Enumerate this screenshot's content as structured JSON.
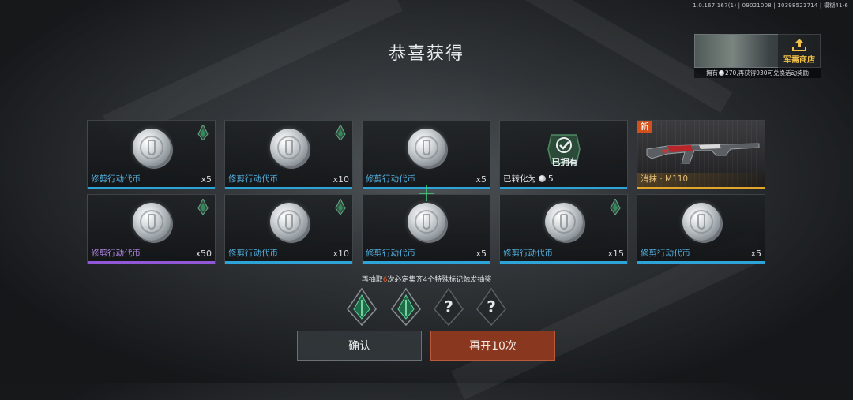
{
  "version": "1.0.167.167(1) | 09021008 | 10398521714 | 模糊41-6",
  "title": "恭喜获得",
  "shop": {
    "label": "军需商店",
    "info_prefix": "拥有",
    "info_amount": "270",
    "info_suffix": ",再获得930可兑换活动奖励"
  },
  "cards": [
    {
      "name": "修剪行动代币",
      "qty": "x5",
      "rarity": "blue",
      "mark": true
    },
    {
      "name": "修剪行动代币",
      "qty": "x10",
      "rarity": "blue",
      "mark": true
    },
    {
      "name": "修剪行动代币",
      "qty": "x5",
      "rarity": "blue",
      "mark": false
    },
    {
      "owned_label": "已拥有",
      "converted_text": "已转化为",
      "converted_amount": "5",
      "rarity": "blue"
    },
    {
      "badge": "新",
      "name": "消抹 · M110",
      "rarity": "gold"
    },
    {
      "name": "修剪行动代币",
      "qty": "x50",
      "rarity": "purple",
      "mark": true
    },
    {
      "name": "修剪行动代币",
      "qty": "x10",
      "rarity": "blue",
      "mark": true
    },
    {
      "name": "修剪行动代币",
      "qty": "x5",
      "rarity": "blue",
      "mark": false
    },
    {
      "name": "修剪行动代币",
      "qty": "x15",
      "rarity": "blue",
      "mark": true
    },
    {
      "name": "修剪行动代币",
      "qty": "x5",
      "rarity": "blue",
      "mark": false
    }
  ],
  "hint": {
    "prefix": "再抽取",
    "count": "6",
    "suffix": "次必定集齐4个特殊标记触发抽奖"
  },
  "marks": [
    {
      "collected": true
    },
    {
      "collected": true
    },
    {
      "collected": false,
      "symbol": "?"
    },
    {
      "collected": false,
      "symbol": "?"
    }
  ],
  "buttons": {
    "confirm": "确认",
    "again": "再开10次"
  },
  "colors": {
    "blue": "#2ea3d8",
    "purple": "#9057d6",
    "gold": "#e1a52c",
    "accent": "#e8582c"
  }
}
